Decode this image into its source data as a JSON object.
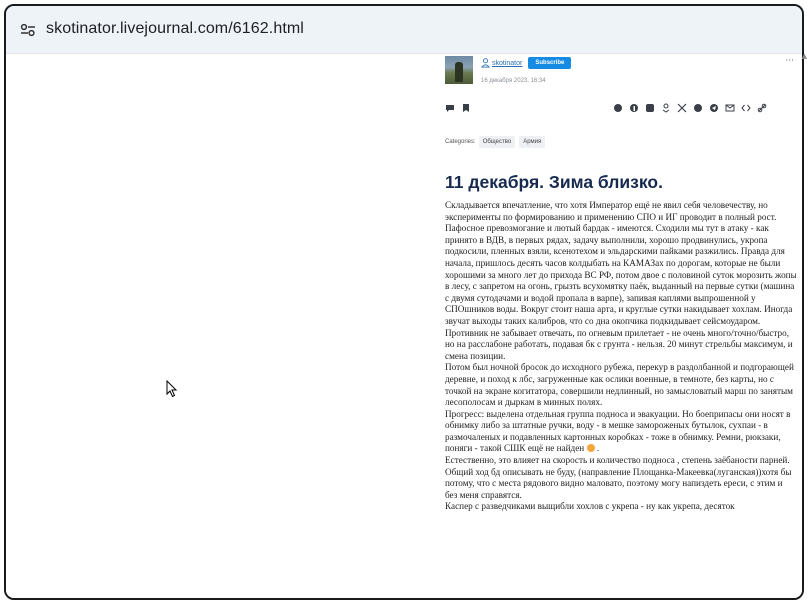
{
  "browser": {
    "url": "skotinator.livejournal.com/6162.html",
    "site_settings_icon": "tune-icon"
  },
  "post": {
    "username": "skotinator",
    "subscribe_label": "Subscribe",
    "date": "16 декабря 2023, 16:34",
    "more_label": "···",
    "categories_label": "Categories:",
    "categories": [
      "Общество",
      "Армия"
    ],
    "title": "11 декабря. Зима близко.",
    "paragraphs": [
      "Складывается впечатление, что хотя Император ещё не явил себя человечеству, но эксперименты по формированию и применению СПО и ИГ проводит в полный рост. Пафосное превозмогание и лютый бардак - имеются. Сходили мы тут в атаку - как принято в ВДВ, в первых рядах, задачу выполнили, хорошо продвинулись, укропа подкосили, пленных взяли, ксенотехом и эльдарскими пайками разжились. Правда для начала, пришлось десять часов колдыбать на КАМАЗах по дорогам, которые не были хорошими за много лет до прихода ВС РФ, потом двое с половиной суток морозить жопы в лесу, с запретом на огонь, грызть всухомятку паёк, выданный на первые сутки (машина с двумя сутодачами и водой пропала в варпе), запивая каплями выпрошенной у СПОшников воды. Вокруг стоит наша арта, и круглые сутки накидывает хохлам. Иногда звучат выходы таких калибров, что со дна окопчика подкидывает сейсмоударом. Противник не забывает отвечать, по огневым прилетает - не очень много/точно/быстро, но на расслабоне работать, подавая бк с грунта - нельзя. 20 минут стрельбы максимум, и смена позиции.",
      "Потом был ночной бросок до исходного рубежа, перекур в раздолбанной и подгорающей деревне, и поход к лбс, загруженные как ослики военные, в темноте, без карты, но с точкой на экране когитатора, совершили недлинный, но замысловатый марш по занятым лесополосам и дыркам в минных полях.",
      "Прогресс: выделена отдельная группа подноса и эвакуации. Но боеприпасы они носят в обнимку либо за штатные ручки, воду - в мешке замороженых бутылок, сухпаи - в размочаленых и подавленных картонных коробках - тоже в обнимку. Ремни, рюкзаки, поняги - такой СШК ещё не найден",
      "Естественно, это влияет на скорость и количество подноса , степень заёбаности парней.",
      "Общий ход бд описывать не буду, (направление Площанка-Макеевка(луганская))хотя бы потому, что с места рядового видно маловато, поэтому могу напиздеть ереси, с этим и без меня справятся.",
      "Каспер с разведчиками выщибли хохлов с укрепа - ну как укрепа, десяток"
    ]
  }
}
